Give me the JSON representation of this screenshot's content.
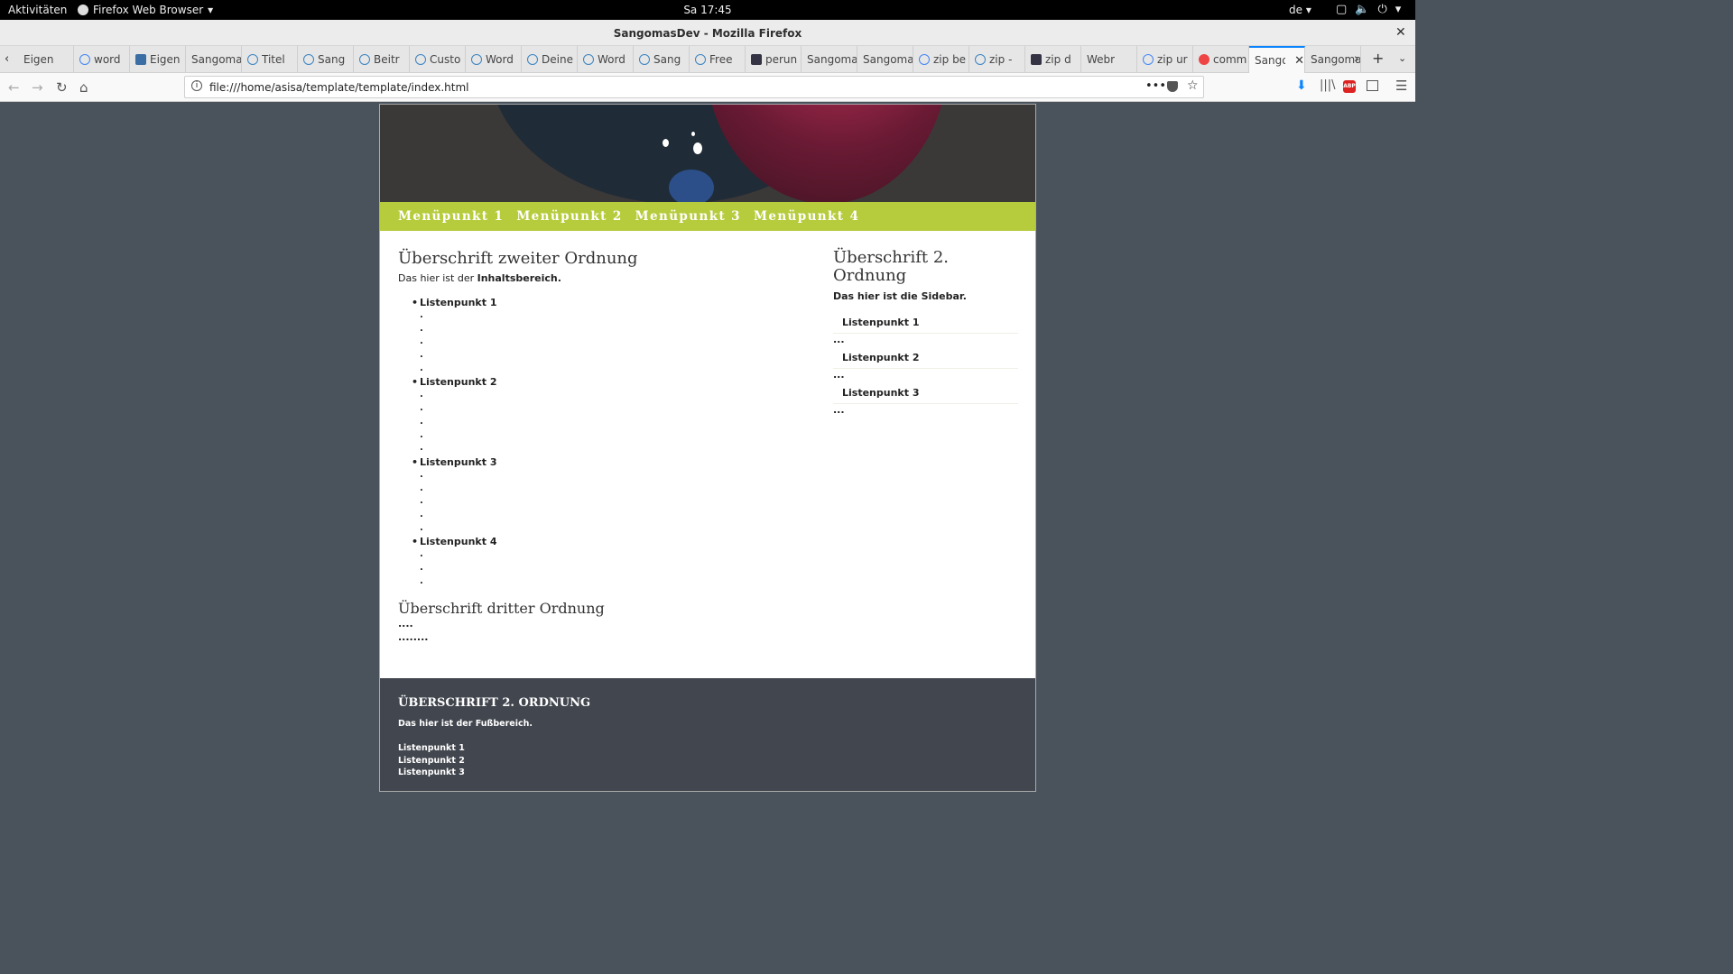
{
  "gnome": {
    "activities": "Aktivitäten",
    "app_menu": "Firefox Web Browser",
    "clock": "Sa 17:45",
    "lang": "de"
  },
  "window": {
    "title": "SangomasDev - Mozilla Firefox"
  },
  "tabs": [
    {
      "label": "Eigen",
      "icon": "none"
    },
    {
      "label": "word",
      "icon": "g"
    },
    {
      "label": "Eigen",
      "icon": "sq"
    },
    {
      "label": "Sangoma",
      "icon": "none"
    },
    {
      "label": "Titel",
      "icon": "wp"
    },
    {
      "label": "Sang",
      "icon": "wp"
    },
    {
      "label": "Beitr",
      "icon": "wp"
    },
    {
      "label": "Custo",
      "icon": "wp"
    },
    {
      "label": "Word",
      "icon": "wp"
    },
    {
      "label": "Deine",
      "icon": "wp"
    },
    {
      "label": "Word",
      "icon": "wp"
    },
    {
      "label": "Sang",
      "icon": "wp"
    },
    {
      "label": "Free",
      "icon": "wp"
    },
    {
      "label": "perun",
      "icon": "dark"
    },
    {
      "label": "Sangoma",
      "icon": "none"
    },
    {
      "label": "Sangoma",
      "icon": "none"
    },
    {
      "label": "zip be",
      "icon": "g"
    },
    {
      "label": "zip -",
      "icon": "wp"
    },
    {
      "label": "zip d",
      "icon": "dark"
    },
    {
      "label": "Webr",
      "icon": "none"
    },
    {
      "label": "zip ur",
      "icon": "g"
    },
    {
      "label": "comm",
      "icon": "red"
    },
    {
      "label": "Sango",
      "icon": "none",
      "active": true
    },
    {
      "label": "Sangoma",
      "icon": "none"
    }
  ],
  "navbar": {
    "url": "file:///home/asisa/template/template/index.html"
  },
  "site": {
    "menu": [
      "Menüpunkt 1",
      "Menüpunkt 2",
      "Menüpunkt 3",
      "Menüpunkt 4"
    ],
    "content": {
      "heading": "Überschrift zweiter Ordnung",
      "intro_plain": "Das hier ist der ",
      "intro_bold": "Inhaltsbereich.",
      "list": [
        "Listenpunkt 1",
        "Listenpunkt 2",
        "Listenpunkt 3",
        "Listenpunkt 4"
      ],
      "dot": ".",
      "heading3": "Überschrift dritter Ordnung",
      "line1": "....",
      "line2": "........"
    },
    "sidebar": {
      "heading": "Überschrift 2. Ordnung",
      "text": "Das hier ist die Sidebar.",
      "items": [
        "Listenpunkt 1",
        "Listenpunkt 2",
        "Listenpunkt 3"
      ],
      "ellipsis": "..."
    },
    "footer": {
      "heading": "ÜBERSCHRIFT 2. ORDNUNG",
      "text": "Das hier ist der Fußbereich.",
      "items": [
        "Listenpunkt 1",
        "Listenpunkt 2",
        "Listenpunkt 3"
      ]
    },
    "colors": {
      "nav_bg": "#b7cc3d",
      "footer_bg": "#42464e",
      "page_bg": "#4a525b"
    }
  }
}
